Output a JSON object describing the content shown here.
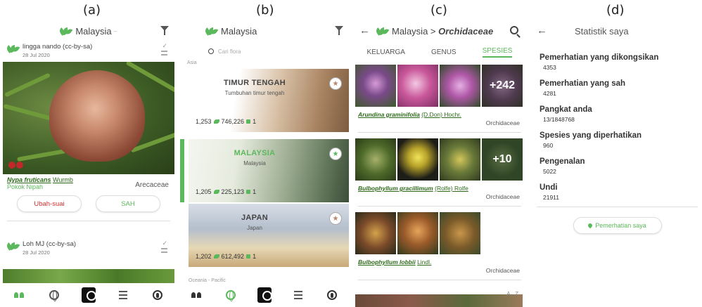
{
  "labels": [
    "(a)",
    "(b)",
    "(c)",
    "(d)"
  ],
  "a": {
    "header": "Malaysia",
    "obs1": {
      "user": "lingga nando (cc-by-sa)",
      "date": "28 Jul 2020"
    },
    "species": {
      "latin": "Nypa fruticans",
      "author": "Wurmb",
      "common": "Pokok Nipah",
      "family": "Arecaceae"
    },
    "buttons": {
      "edit": "Ubah-suai",
      "valid": "SAH"
    },
    "obs2": {
      "user": "Loh MJ (cc-by-sa)",
      "date": "28 Jul 2020"
    }
  },
  "b": {
    "header": "Malaysia",
    "search_placeholder": "Cari flora",
    "region_asia": "Asia",
    "places": [
      {
        "title": "TIMUR TENGAH",
        "sub": "Tumbuhan timur tengah",
        "count1": "1,253",
        "count2": "746,226",
        "count3": "1"
      },
      {
        "title": "MALAYSIA",
        "sub": "Malaysia",
        "count1": "1,205",
        "count2": "225,123",
        "count3": "1"
      },
      {
        "title": "JAPAN",
        "sub": "Japan",
        "count1": "1,202",
        "count2": "612,492",
        "count3": "1"
      }
    ],
    "region_oceania": "Oceania - Pacific"
  },
  "c": {
    "crumb_place": "Malaysia >",
    "crumb_family": "Orchidaceae",
    "tabs": [
      "KELUARGA",
      "GENUS",
      "SPESIES"
    ],
    "species": [
      {
        "latin": "Arundina graminifolia",
        "author": "(D.Don) Hochr.",
        "family": "Orchidaceae",
        "more": "+242"
      },
      {
        "latin": "Bulbophyllum gracillimum",
        "author": "(Rolfe) Rolfe",
        "family": "Orchidaceae",
        "more": "+10"
      },
      {
        "latin": "Bulbophyllum lobbii",
        "author": "Lindl.",
        "family": "Orchidaceae",
        "more": ""
      }
    ],
    "az": "A...Z"
  },
  "d": {
    "title": "Statistik saya",
    "stats": [
      {
        "k": "Pemerhatian yang dikongsikan",
        "v": "4353"
      },
      {
        "k": "Pemerhatian yang sah",
        "v": "4281"
      },
      {
        "k": "Pangkat anda",
        "v": "13/1848768"
      },
      {
        "k": "Spesies yang diperhatikan",
        "v": "960"
      },
      {
        "k": "Pengenalan",
        "v": "5022"
      },
      {
        "k": "Undi",
        "v": "21911"
      }
    ],
    "button": "Pemerhatian saya"
  }
}
